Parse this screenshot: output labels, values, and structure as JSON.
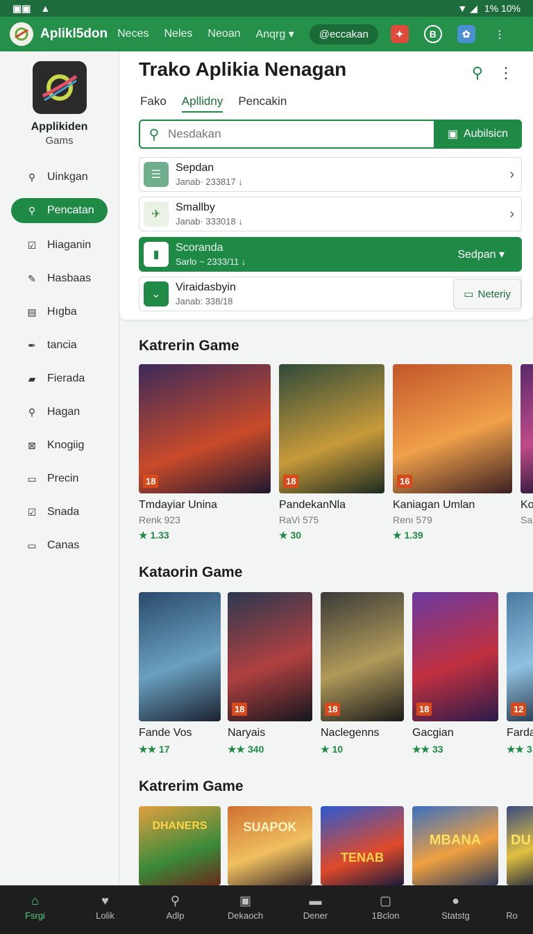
{
  "statusbar": {
    "left_icons": [
      "sim-icon",
      "alert-icon"
    ],
    "battery": "1% 10%"
  },
  "topbar": {
    "app_name": "Aplikl5don",
    "nav": [
      "Neces",
      "Neles",
      "Neoan",
      "Anqrg"
    ],
    "chip": "@eccakan"
  },
  "sidebar": {
    "brand_name": "Applikiden",
    "brand_sub": "Gams",
    "items": [
      {
        "label": "Uinkgan",
        "icon": "search-icon"
      },
      {
        "label": "Pencatan",
        "icon": "search-icon",
        "active": true
      },
      {
        "label": "Hiaganin",
        "icon": "check-icon"
      },
      {
        "label": "Hasbaas",
        "icon": "edit-icon"
      },
      {
        "label": "Hıgba",
        "icon": "briefcase-icon"
      },
      {
        "label": "tancia",
        "icon": "pen-icon"
      },
      {
        "label": "Fierada",
        "icon": "folder-icon"
      },
      {
        "label": "Hagan",
        "icon": "search-icon"
      },
      {
        "label": "Knogiig",
        "icon": "grid-icon"
      },
      {
        "label": "Precin",
        "icon": "box-icon"
      },
      {
        "label": "Snada",
        "icon": "check-icon"
      },
      {
        "label": "Canas",
        "icon": "card-icon"
      }
    ]
  },
  "panel": {
    "title": "Trako Aplikia Nenagan",
    "tabs": [
      "Fako",
      "Apllidny",
      "Pencakin"
    ],
    "search": {
      "placeholder": "Nesdakan",
      "button": "Aubilsicn"
    },
    "rows": [
      {
        "title": "Sepdan",
        "sub": "Janab· 233817 ↓",
        "accent": "#6fae8c"
      },
      {
        "title": "Smallby",
        "sub": "Janab· 333018 ↓",
        "accent": "#8fbf6b"
      },
      {
        "title": "Scoranda",
        "sub": "Sarlo ~ 2333/11 ↓",
        "action": "Sedpan ▾",
        "accent": "#1a6b36"
      },
      {
        "title": "Viraidasbyin",
        "sub": "Janab: 338/18",
        "action": "Neteriy",
        "accent": "#1f8a45"
      }
    ]
  },
  "sections": [
    {
      "title": "Katrerin Game",
      "games": [
        {
          "name": "Tmdayiar Unina",
          "sub": "Renk 923",
          "rating": "1.33",
          "cover": [
            "#3b2a5a",
            "#c94a2a",
            "#1d1830"
          ]
        },
        {
          "name": "PandekanNla",
          "sub": "RaVi 575",
          "rating": "30",
          "cover": [
            "#2f4a3a",
            "#c79a3a",
            "#1b2a22"
          ]
        },
        {
          "name": "Kaniagan Umlan",
          "sub": "Renı 579",
          "rating": "1.39",
          "cover": [
            "#c2562a",
            "#f0a04a",
            "#3a1f22"
          ]
        },
        {
          "name": "Ko",
          "sub": "Sa",
          "rating": "",
          "cover": [
            "#5a2a6a",
            "#c04a8a",
            "#2a1a3a"
          ]
        }
      ]
    },
    {
      "title": "Kataorin Game",
      "games": [
        {
          "name": "Fande Vos",
          "rating": "17",
          "cover": [
            "#2a4a6a",
            "#6aa0c0",
            "#1a2230"
          ]
        },
        {
          "name": "Naryais",
          "rating": "340",
          "cover": [
            "#2a3850",
            "#b04040",
            "#12161e"
          ]
        },
        {
          "name": "Naclegenns",
          "rating": "10",
          "cover": [
            "#3a3a38",
            "#b09a5a",
            "#1a1a1a"
          ]
        },
        {
          "name": "Gacgian",
          "rating": "33",
          "cover": [
            "#6a3aa0",
            "#c03040",
            "#2a1a4a"
          ]
        },
        {
          "name": "Farda",
          "rating": "3",
          "cover": [
            "#4a7aa0",
            "#90c0e0",
            "#23364a"
          ]
        }
      ]
    },
    {
      "title": "Katrerim Game",
      "games": [
        {
          "cover": [
            "#e0a040",
            "#3a8a3a",
            "#6a2a1a"
          ],
          "logo": "DHANERS"
        },
        {
          "cover": [
            "#d07030",
            "#f0c060",
            "#3a2a2a"
          ],
          "logo": "SUAPOK"
        },
        {
          "cover": [
            "#2a5ad0",
            "#e04a2a",
            "#1a1a3a"
          ],
          "logo": "TENAB"
        },
        {
          "cover": [
            "#3a70c0",
            "#f0a040",
            "#2a3a5a"
          ],
          "logo": "MBANA"
        },
        {
          "cover": [
            "#3a4a80",
            "#e0c040",
            "#1a2240"
          ],
          "logo": "DU"
        }
      ]
    }
  ],
  "bottombar": [
    {
      "label": "Fsrgi",
      "icon": "home-icon",
      "active": true
    },
    {
      "label": "Lolik",
      "icon": "heart-icon"
    },
    {
      "label": "Adlp",
      "icon": "search-icon"
    },
    {
      "label": "Dekaoch",
      "icon": "bag-icon"
    },
    {
      "label": "Dener",
      "icon": "gamepad-icon"
    },
    {
      "label": "1Bclon",
      "icon": "tv-icon"
    },
    {
      "label": "Statstg",
      "icon": "person-icon"
    },
    {
      "label": "Ro",
      "icon": "more-icon"
    }
  ]
}
